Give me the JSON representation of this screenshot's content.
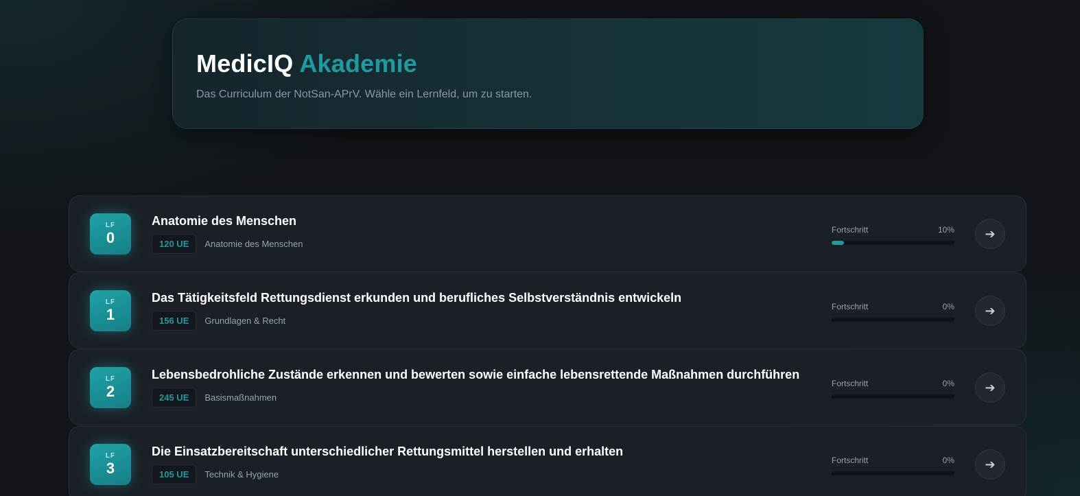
{
  "hero": {
    "title_main": "MedicIQ",
    "title_accent": "Akademie",
    "subtitle": "Das Curriculum der NotSan-APrV. Wähle ein Lernfeld, um zu starten."
  },
  "progress_label": "Fortschritt",
  "arrow_icon": "arrow-right-icon",
  "colors": {
    "accent": "#1f9aa0",
    "card": "#1b1f26",
    "background": "#111418"
  },
  "modules": [
    {
      "lf": "LF",
      "number": "0",
      "title": "Anatomie des Menschen",
      "ue": "120 UE",
      "category": "Anatomie des Menschen",
      "progress_text": "10%",
      "progress_value": 10
    },
    {
      "lf": "LF",
      "number": "1",
      "title": "Das Tätigkeitsfeld Rettungsdienst erkunden und berufliches Selbstverständnis entwickeln",
      "ue": "156 UE",
      "category": "Grundlagen & Recht",
      "progress_text": "0%",
      "progress_value": 0
    },
    {
      "lf": "LF",
      "number": "2",
      "title": "Lebensbedrohliche Zustände erkennen und bewerten sowie einfache lebensrettende Maßnahmen durchführen",
      "ue": "245 UE",
      "category": "Basismaßnahmen",
      "progress_text": "0%",
      "progress_value": 0
    },
    {
      "lf": "LF",
      "number": "3",
      "title": "Die Einsatzbereitschaft unterschiedlicher Rettungsmittel herstellen und erhalten",
      "ue": "105 UE",
      "category": "Technik & Hygiene",
      "progress_text": "0%",
      "progress_value": 0
    }
  ]
}
